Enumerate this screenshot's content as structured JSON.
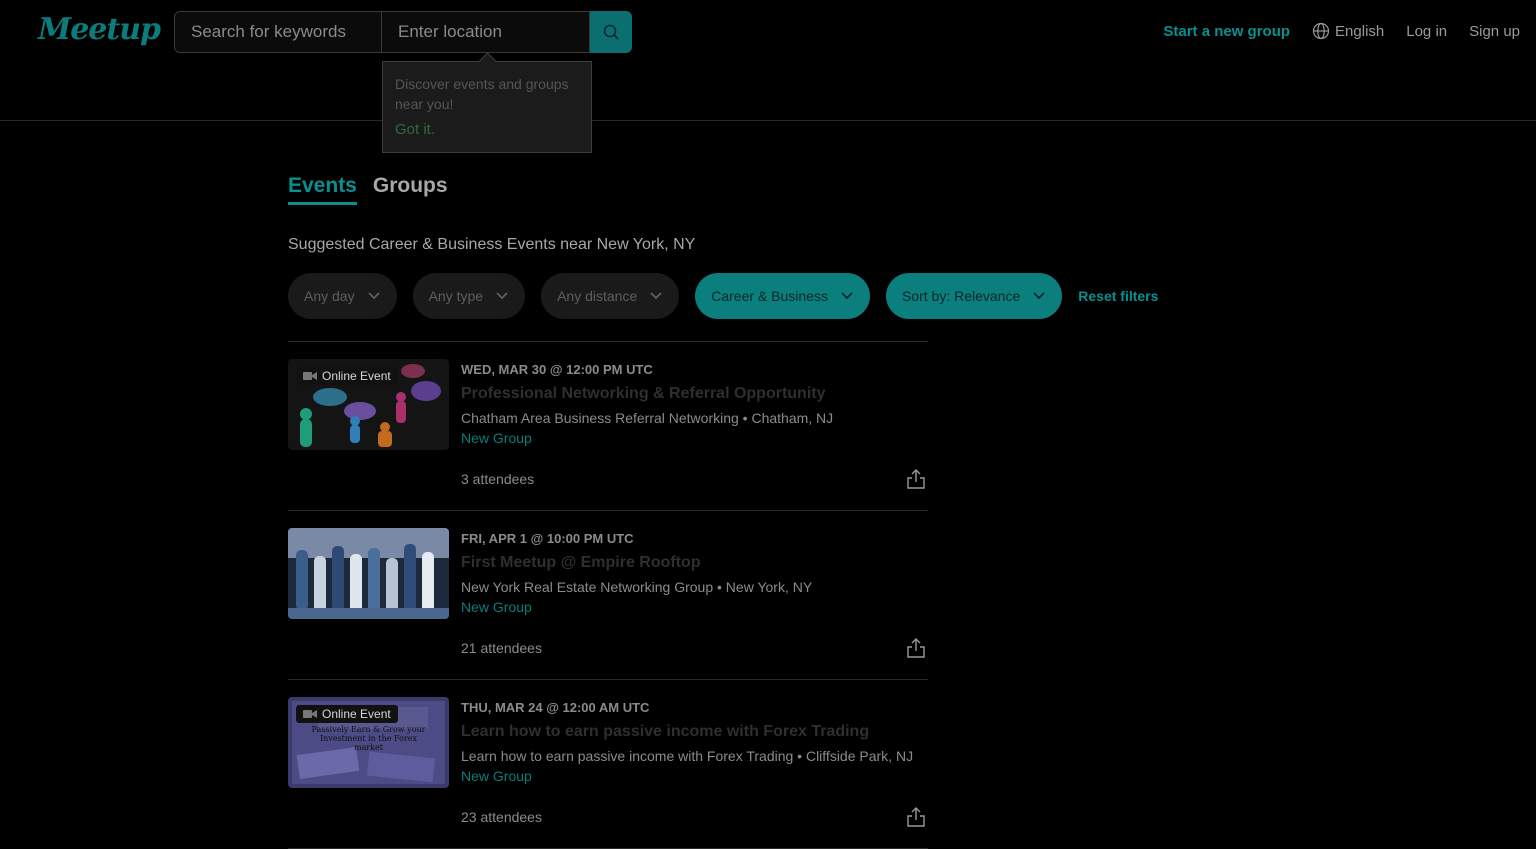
{
  "header": {
    "logo": "Meetup",
    "search": {
      "keyword_placeholder": "Search for keywords",
      "location_placeholder": "Enter location",
      "icon": "search-icon"
    },
    "nav": {
      "start_group": "Start a new group",
      "language": "English",
      "login": "Log in",
      "signup": "Sign up"
    }
  },
  "tooltip": {
    "text": "Discover events and groups near you!",
    "action": "Got it."
  },
  "tabs": [
    {
      "label": "Events",
      "active": true
    },
    {
      "label": "Groups",
      "active": false
    }
  ],
  "subtitle": "Suggested Career & Business Events near New York, NY",
  "filters": {
    "day": "Any day",
    "type": "Any type",
    "distance": "Any distance",
    "category": "Career & Business",
    "sort": "Sort by: Relevance",
    "reset": "Reset filters"
  },
  "events": [
    {
      "date": "WED, MAR 30 @ 12:00 PM UTC",
      "title": "Professional Networking & Referral Opportunity",
      "group": "Chatham Area Business Referral Networking • Chatham, NJ",
      "new_group": "New Group",
      "attendees": "3 attendees",
      "badge": "Online Event"
    },
    {
      "date": "FRI, APR 1 @ 10:00 PM UTC",
      "title": "First Meetup @ Empire Rooftop",
      "group": "New York Real Estate Networking Group • New York, NY",
      "new_group": "New Group",
      "attendees": "21 attendees",
      "badge": ""
    },
    {
      "date": "THU, MAR 24 @ 12:00 AM UTC",
      "title": "Learn how to earn passive income with Forex Trading",
      "group": "Learn how to earn passive income with Forex Trading • Cliffside Park, NJ",
      "new_group": "New Group",
      "attendees": "23 attendees",
      "badge": "Online Event",
      "thumb_text": "Passively Earn & Grow your Investment in the Forex market"
    }
  ],
  "colors": {
    "accent": "#0a8f8f",
    "background": "#000000"
  }
}
